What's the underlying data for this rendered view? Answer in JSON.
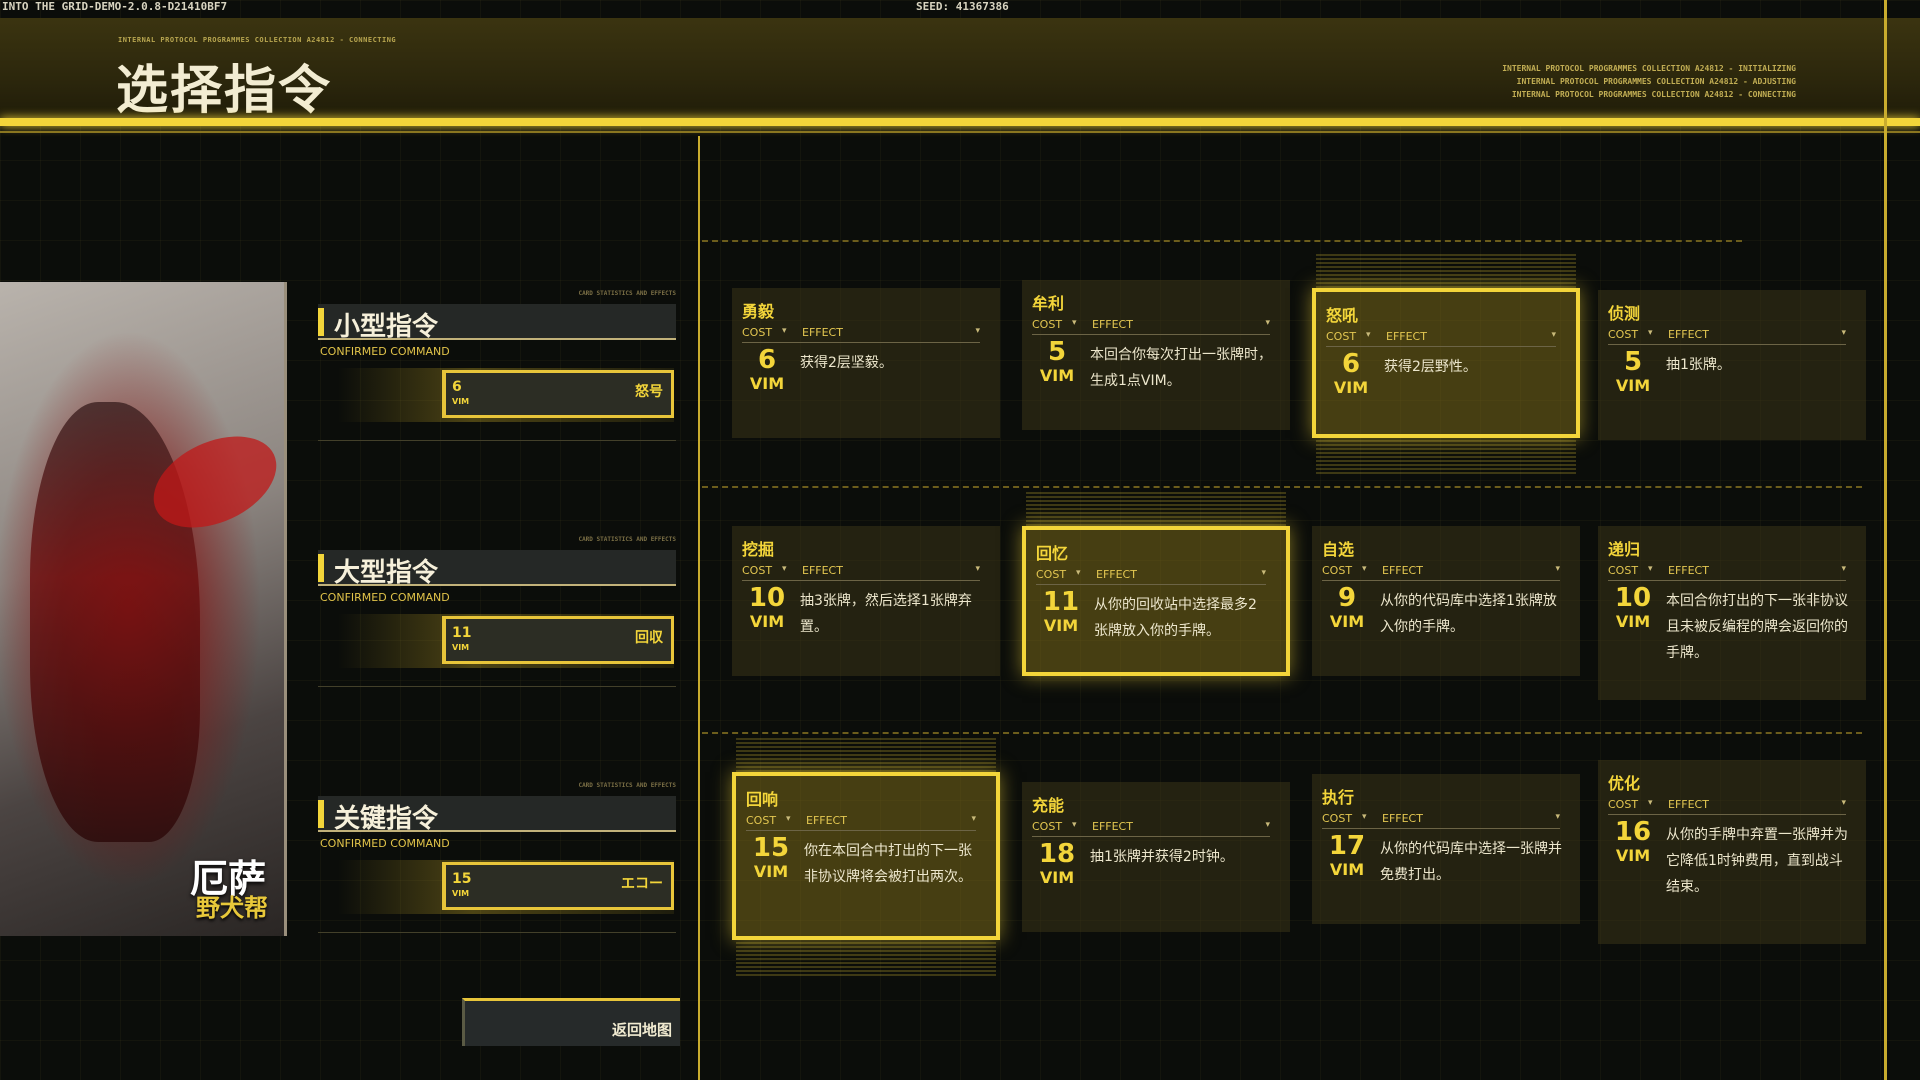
{
  "top": {
    "build": "INTO THE GRID-DEMO-2.0.8-D21410BF7",
    "seed": "SEED: 41367386",
    "small_caption": "INTERNAL PROTOCOL PROGRAMMES COLLECTION A24812 - CONNECTING",
    "right_lines": [
      "INTERNAL PROTOCOL PROGRAMMES COLLECTION A24812 - INITIALIZING",
      "INTERNAL PROTOCOL PROGRAMMES COLLECTION A24812 - ADJUSTING",
      "INTERNAL PROTOCOL PROGRAMMES COLLECTION A24812 - CONNECTING"
    ]
  },
  "page_title": "选择指令",
  "character": {
    "name": "厄萨",
    "subtitle": "野犬帮"
  },
  "slots": [
    {
      "title": "小型指令",
      "sub": "CONFIRMED COMMAND",
      "tiny": "CARD STATISTICS AND EFFECTS",
      "cost": "6",
      "vim": "VIM",
      "card": "怒号"
    },
    {
      "title": "大型指令",
      "sub": "CONFIRMED COMMAND",
      "tiny": "CARD STATISTICS AND EFFECTS",
      "cost": "11",
      "vim": "VIM",
      "card": "回収"
    },
    {
      "title": "关键指令",
      "sub": "CONFIRMED COMMAND",
      "tiny": "CARD STATISTICS AND EFFECTS",
      "cost": "15",
      "vim": "VIM",
      "card": "エコー"
    }
  ],
  "return_label": "返回地图",
  "labels": {
    "cost": "COST",
    "effect": "EFFECT",
    "vim": "VIM",
    "dropdown": "▾"
  },
  "cards": [
    {
      "name": "勇毅",
      "cost": "6",
      "desc": "获得2层坚毅。"
    },
    {
      "name": "牟利",
      "cost": "5",
      "desc": "本回合你每次打出一张牌时，生成1点VIM。"
    },
    {
      "name": "怒吼",
      "cost": "6",
      "desc": "获得2层野性。"
    },
    {
      "name": "侦测",
      "cost": "5",
      "desc": "抽1张牌。"
    },
    {
      "name": "挖掘",
      "cost": "10",
      "desc": "抽3张牌，然后选择1张牌弃置。"
    },
    {
      "name": "回忆",
      "cost": "11",
      "desc": "从你的回收站中选择最多2张牌放入你的手牌。"
    },
    {
      "name": "自选",
      "cost": "9",
      "desc": "从你的代码库中选择1张牌放入你的手牌。"
    },
    {
      "name": "递归",
      "cost": "10",
      "desc": "本回合你打出的下一张非协议且未被反编程的牌会返回你的手牌。"
    },
    {
      "name": "回响",
      "cost": "15",
      "desc": "你在本回合中打出的下一张非协议牌将会被打出两次。"
    },
    {
      "name": "充能",
      "cost": "18",
      "desc": "抽1张牌并获得2时钟。"
    },
    {
      "name": "执行",
      "cost": "17",
      "desc": "从你的代码库中选择一张牌并免费打出。"
    },
    {
      "name": "优化",
      "cost": "16",
      "desc": "从你的手牌中弃置一张牌并为它降低1时钟费用，直到战斗结束。"
    }
  ]
}
